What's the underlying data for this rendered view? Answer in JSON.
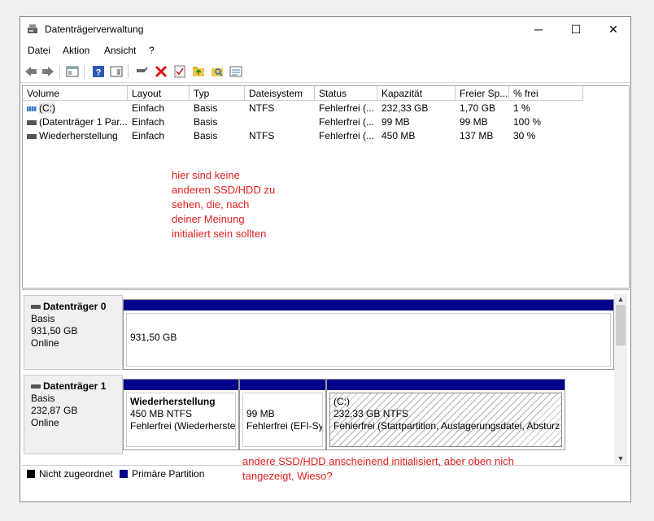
{
  "window": {
    "title": "Datenträgerverwaltung",
    "minimize": "─",
    "maximize": "☐",
    "close": "✕"
  },
  "menu": [
    "Datei",
    "Aktion",
    "Ansicht",
    "?"
  ],
  "toolbar_icons": [
    "back-icon",
    "forward-icon",
    "properties-icon",
    "help-icon",
    "console-icon",
    "connect-icon",
    "delete-icon",
    "check-icon",
    "folder-icon",
    "search-icon",
    "list-icon"
  ],
  "columns": [
    "Volume",
    "Layout",
    "Typ",
    "Dateisystem",
    "Status",
    "Kapazität",
    "Freier Sp...",
    "% frei"
  ],
  "rows": [
    [
      "(C:)",
      "Einfach",
      "Basis",
      "NTFS",
      "Fehlerfrei (...",
      "232,33 GB",
      "1,70 GB",
      "1 %"
    ],
    [
      "(Datenträger 1 Par...",
      "Einfach",
      "Basis",
      "",
      "Fehlerfrei (...",
      "99 MB",
      "99 MB",
      "100 %"
    ],
    [
      "Wiederherstellung",
      "Einfach",
      "Basis",
      "NTFS",
      "Fehlerfrei (...",
      "450 MB",
      "137 MB",
      "30 %"
    ]
  ],
  "annotation_top": [
    "hier sind keine",
    "anderen SSD/HDD zu",
    "sehen, die, nach",
    "deiner Meinung",
    "initialiert sein sollten"
  ],
  "annotation_bottom": [
    "andere SSD/HDD anscheinend initialisiert, aber oben nich",
    "tangezeigt, Wieso?"
  ],
  "disk0": {
    "name": "Datenträger 0",
    "type": "Basis",
    "size": "931,50 GB",
    "state": "Online",
    "partition": {
      "size": "931,50 GB"
    }
  },
  "disk1": {
    "name": "Datenträger 1",
    "type": "Basis",
    "size": "232,87 GB",
    "state": "Online",
    "partitions": [
      {
        "name": "Wiederherstellung",
        "size": "450 MB NTFS",
        "status": "Fehlerfrei (Wiederherstel"
      },
      {
        "name": "",
        "size": "99 MB",
        "status": "Fehlerfrei (EFI-Sys"
      },
      {
        "name": "(C:)",
        "size": "232,33 GB NTFS",
        "status": "Fehlerfrei (Startpartition, Auslagerungsdatei, Absturz"
      }
    ]
  },
  "legend": {
    "unallocated": "Nicht zugeordnet",
    "primary": "Primäre Partition",
    "unallocated_color": "#000000",
    "primary_color": "#00008a"
  }
}
